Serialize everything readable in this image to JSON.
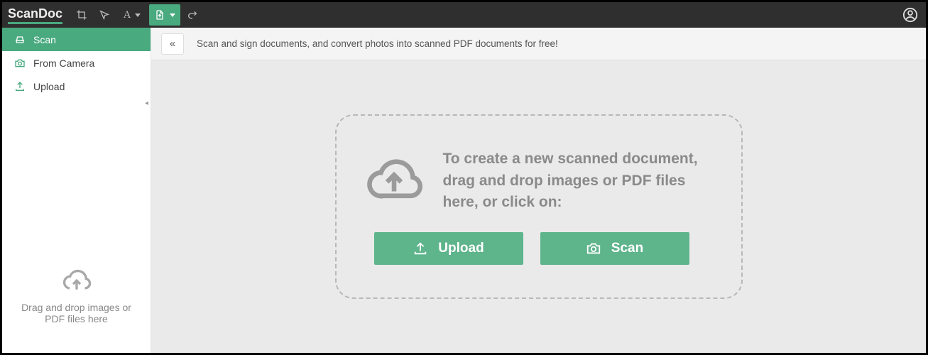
{
  "toolbar": {
    "brand": "ScanDoc",
    "icons": {
      "crop": "crop-icon",
      "cursor": "cursor-icon",
      "text": "A",
      "file": "file-icon",
      "redo": "redo-icon",
      "user": "user-circle-icon"
    }
  },
  "infobar": {
    "text": "Scan and sign documents, and convert photos into scanned PDF documents for free!"
  },
  "sidebar": {
    "items": [
      {
        "id": "scan",
        "label": "Scan",
        "icon": "scanner-icon"
      },
      {
        "id": "from-camera",
        "label": "From Camera",
        "icon": "camera-icon"
      },
      {
        "id": "upload",
        "label": "Upload",
        "icon": "upload-icon"
      }
    ],
    "drop_hint_line1": "Drag and drop images or",
    "drop_hint_line2": "PDF files here"
  },
  "dropzone": {
    "text": "To create a new scanned document, drag and drop images or PDF files here, or click on:",
    "upload_label": "Upload",
    "scan_label": "Scan"
  }
}
